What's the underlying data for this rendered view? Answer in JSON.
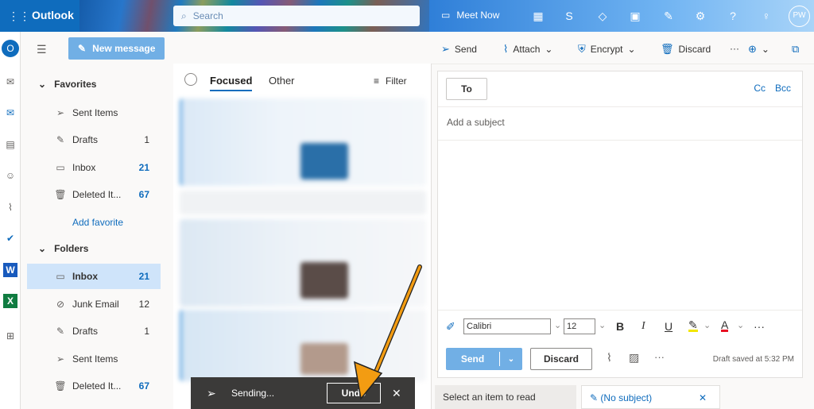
{
  "topbar": {
    "app_name": "Outlook",
    "search_placeholder": "Search",
    "meet_now": "Meet Now",
    "avatar_initials": "PW"
  },
  "nav": {
    "new_message": "New message",
    "favorites_label": "Favorites",
    "favorites": [
      {
        "label": "Sent Items",
        "count": ""
      },
      {
        "label": "Drafts",
        "count": "1"
      },
      {
        "label": "Inbox",
        "count": "21"
      },
      {
        "label": "Deleted It...",
        "count": "67"
      }
    ],
    "add_favorite": "Add favorite",
    "folders_label": "Folders",
    "folders": [
      {
        "label": "Inbox",
        "count": "21"
      },
      {
        "label": "Junk Email",
        "count": "12"
      },
      {
        "label": "Drafts",
        "count": "1"
      },
      {
        "label": "Sent Items",
        "count": ""
      },
      {
        "label": "Deleted It...",
        "count": "67"
      }
    ]
  },
  "list": {
    "tab_focused": "Focused",
    "tab_other": "Other",
    "filter": "Filter"
  },
  "commands": {
    "send": "Send",
    "attach": "Attach",
    "encrypt": "Encrypt",
    "discard": "Discard"
  },
  "compose": {
    "to": "To",
    "cc": "Cc",
    "bcc": "Bcc",
    "subject_placeholder": "Add a subject",
    "font": "Calibri",
    "size": "12",
    "send": "Send",
    "discard": "Discard",
    "saved": "Draft saved at 5:32 PM"
  },
  "bottom": {
    "select_item": "Select an item to read",
    "draft_tab": "(No subject)"
  },
  "toast": {
    "status": "Sending...",
    "undo": "Undo"
  }
}
